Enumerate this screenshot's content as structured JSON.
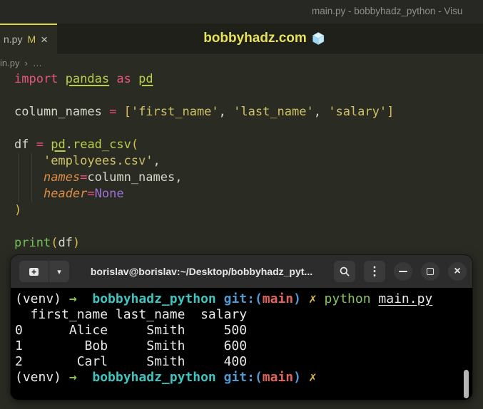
{
  "colors": {
    "accent_yellow": "#d8d83e",
    "watermark_yellow": "#e5e15e",
    "editor_bg": "#2a2c24",
    "terminal_bg": "#000000",
    "terminal_header_bg": "#2c2c2c",
    "keyword_pink": "#e8537e",
    "module_green": "#b9cf4a",
    "string_yellow": "#cfc164",
    "bracket_gold": "#d8b94e",
    "param_orange": "#de8c45",
    "none_purple": "#9b6fd4",
    "builtin_green": "#72c058",
    "prompt_arrow_green": "#8ac43f",
    "prompt_cyan": "#3ec5c0",
    "prompt_blue": "#4f99d3",
    "prompt_red": "#e0635e",
    "prompt_yellow": "#d9b44a",
    "prompt_green": "#88c46a"
  },
  "window": {
    "title": "main.py - bobbyhadz_python - Visu"
  },
  "tabbar": {
    "tab_label": "n.py",
    "modified_badge": "M",
    "close_glyph": "×",
    "watermark": "bobbyhadz.com"
  },
  "breadcrumb": {
    "file": "in.py",
    "sep": "›",
    "more": "…"
  },
  "editor": {
    "code_lines": [
      [
        {
          "t": "import",
          "c": "kw"
        },
        {
          "t": " ",
          "c": "pl"
        },
        {
          "t": "pandas",
          "c": "mod"
        },
        {
          "t": " ",
          "c": "pl"
        },
        {
          "t": "as",
          "c": "kw"
        },
        {
          "t": " ",
          "c": "pl"
        },
        {
          "t": "pd",
          "c": "mod"
        }
      ],
      [],
      [
        {
          "t": "column_names",
          "c": "pl"
        },
        {
          "t": " ",
          "c": "pl"
        },
        {
          "t": "=",
          "c": "kw"
        },
        {
          "t": " ",
          "c": "pl"
        },
        {
          "t": "[",
          "c": "brk"
        },
        {
          "t": "'first_name'",
          "c": "str"
        },
        {
          "t": ", ",
          "c": "pl"
        },
        {
          "t": "'last_name'",
          "c": "str"
        },
        {
          "t": ", ",
          "c": "pl"
        },
        {
          "t": "'salary'",
          "c": "str"
        },
        {
          "t": "]",
          "c": "brk"
        }
      ],
      [],
      [
        {
          "t": "df",
          "c": "pl"
        },
        {
          "t": " ",
          "c": "pl"
        },
        {
          "t": "=",
          "c": "kw"
        },
        {
          "t": " ",
          "c": "pl"
        },
        {
          "t": "pd",
          "c": "mod"
        },
        {
          "t": ".",
          "c": "pl"
        },
        {
          "t": "read_csv",
          "c": "fn"
        },
        {
          "t": "(",
          "c": "brk"
        }
      ],
      [
        {
          "t": "    ",
          "c": "pl"
        },
        {
          "t": "'employees.csv'",
          "c": "str"
        },
        {
          "t": ",",
          "c": "pl"
        }
      ],
      [
        {
          "t": "    ",
          "c": "pl"
        },
        {
          "t": "names",
          "c": "param"
        },
        {
          "t": "=",
          "c": "kw"
        },
        {
          "t": "column_names",
          "c": "pl"
        },
        {
          "t": ",",
          "c": "pl"
        }
      ],
      [
        {
          "t": "    ",
          "c": "pl"
        },
        {
          "t": "header",
          "c": "param"
        },
        {
          "t": "=",
          "c": "kw"
        },
        {
          "t": "None",
          "c": "const"
        }
      ],
      [
        {
          "t": ")",
          "c": "brk"
        }
      ],
      [],
      [
        {
          "t": "print",
          "c": "builtin"
        },
        {
          "t": "(",
          "c": "brk"
        },
        {
          "t": "df",
          "c": "pl"
        },
        {
          "t": ")",
          "c": "brk"
        }
      ]
    ]
  },
  "terminal": {
    "header": {
      "title": "borislav@borislav:~/Desktop/bobbyhadz_pyt...",
      "dropdown_glyph": "▾",
      "menu_glyph": "⋮",
      "close_glyph": "×"
    },
    "lines": [
      [
        {
          "t": "(venv) ",
          "c": "wh"
        },
        {
          "t": "→  ",
          "c": "arrow"
        },
        {
          "t": "bobbyhadz_python",
          "c": "cyan"
        },
        {
          "t": " ",
          "c": "wh"
        },
        {
          "t": "git:(",
          "c": "blue"
        },
        {
          "t": "main",
          "c": "red"
        },
        {
          "t": ") ",
          "c": "blue"
        },
        {
          "t": "✗ ",
          "c": "yellow"
        },
        {
          "t": "python ",
          "c": "green"
        },
        {
          "t": "main.py",
          "c": "file"
        }
      ],
      [
        {
          "t": "  first_name last_name  salary",
          "c": "wh"
        }
      ],
      [
        {
          "t": "0      Alice     Smith     500",
          "c": "wh"
        }
      ],
      [
        {
          "t": "1        Bob     Smith     600",
          "c": "wh"
        }
      ],
      [
        {
          "t": "2       Carl     Smith     400",
          "c": "wh"
        }
      ],
      [
        {
          "t": "(venv) ",
          "c": "wh"
        },
        {
          "t": "→  ",
          "c": "arrow"
        },
        {
          "t": "bobbyhadz_python",
          "c": "cyan"
        },
        {
          "t": " ",
          "c": "wh"
        },
        {
          "t": "git:(",
          "c": "blue"
        },
        {
          "t": "main",
          "c": "red"
        },
        {
          "t": ") ",
          "c": "blue"
        },
        {
          "t": "✗",
          "c": "yellow"
        }
      ]
    ]
  }
}
